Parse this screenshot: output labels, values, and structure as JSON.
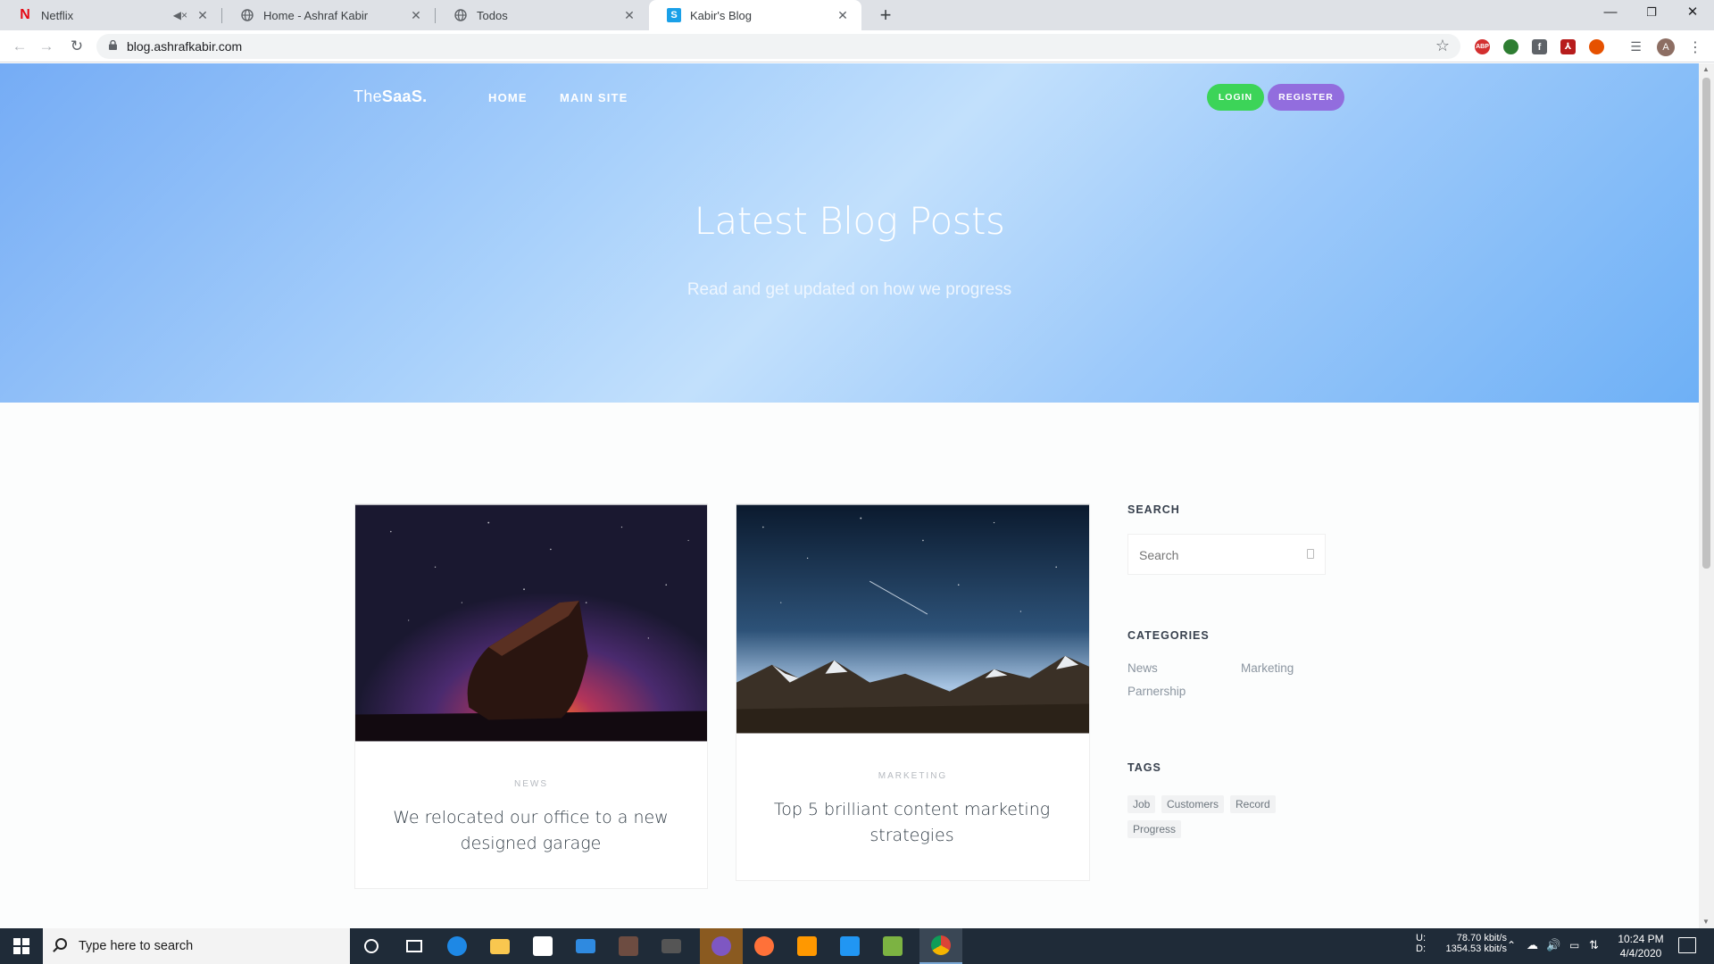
{
  "browser": {
    "tabs": [
      {
        "title": "Netflix",
        "muted": true
      },
      {
        "title": "Home - Ashraf Kabir"
      },
      {
        "title": "Todos"
      },
      {
        "title": "Kabir's Blog",
        "active": true
      }
    ],
    "url": "blog.ashrafkabir.com",
    "profile_initial": "A",
    "extensions": [
      "adblock-plus-icon",
      "globe-extension-icon",
      "facebook-extension-icon",
      "pdf-extension-icon",
      "duckduckgo-icon",
      "reading-list-icon"
    ]
  },
  "site": {
    "logo_light": "The",
    "logo_bold": "SaaS.",
    "nav": [
      "HOME",
      "MAIN SITE"
    ],
    "login": "LOGIN",
    "register": "REGISTER",
    "hero_title": "Latest Blog Posts",
    "hero_subtitle": "Read and get updated on how we progress",
    "posts": [
      {
        "category": "NEWS",
        "title": "We relocated our office to a new designed garage"
      },
      {
        "category": "MARKETING",
        "title": "Top 5 brilliant content marketing strategies"
      }
    ],
    "sidebar": {
      "search_heading": "SEARCH",
      "search_placeholder": "Search",
      "categories_heading": "CATEGORIES",
      "categories": [
        "News",
        "Marketing",
        "Parnership"
      ],
      "tags_heading": "TAGS",
      "tags": [
        "Job",
        "Customers",
        "Record",
        "Progress"
      ]
    }
  },
  "taskbar": {
    "search_placeholder": "Type here to search",
    "net_up_label": "U:",
    "net_up": "78.70 kbit/s",
    "net_down_label": "D:",
    "net_down": "1354.53 kbit/s",
    "time": "10:24 PM",
    "date": "4/4/2020"
  },
  "colors": {
    "login": "#3cd458",
    "register": "#926dde",
    "hero_start": "#75acf5",
    "hero_mid": "#c2e0fc",
    "taskbar": "#1f2b38"
  }
}
